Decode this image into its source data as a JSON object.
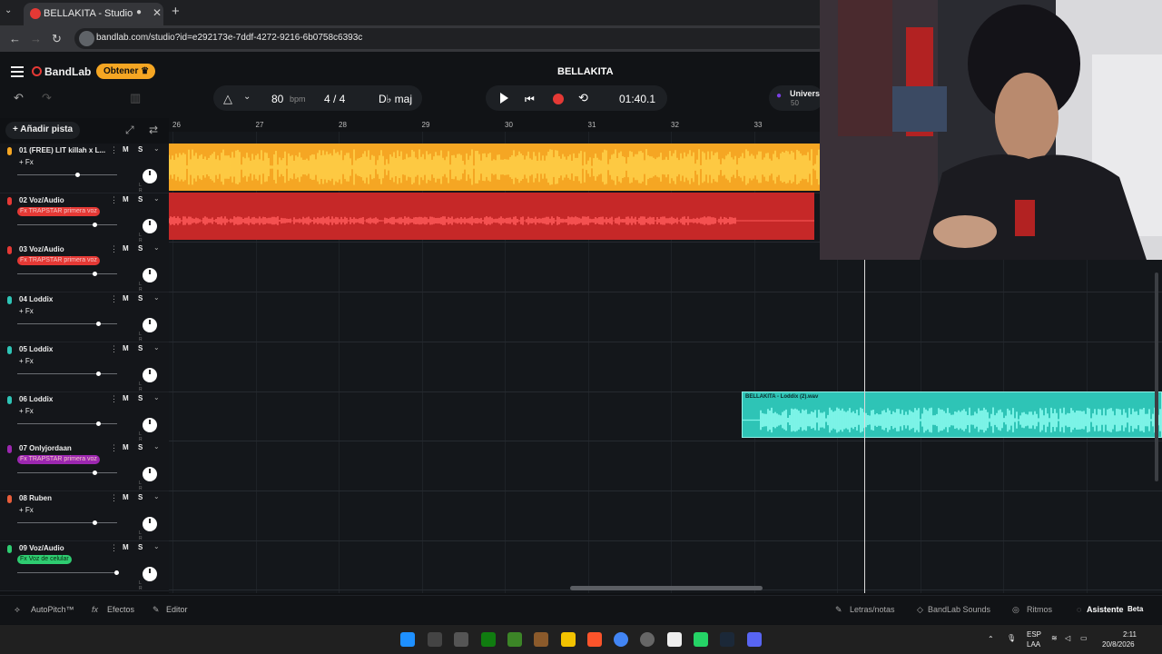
{
  "browser": {
    "tab_title": "BELLAKITA - Studio",
    "tab_chevron": "⌄",
    "close_glyph": "✕",
    "newtab_glyph": "+",
    "url": "bandlab.com/studio?id=e292173e-7ddf-4272-9216-6b0758c6393c"
  },
  "header": {
    "app_name": "BandLab",
    "obtener_label": "Obtener",
    "project_title": "BELLAKITA",
    "bpm_value": "80",
    "bpm_unit": "bpm",
    "time_signature": "4 / 4",
    "key": "D♭ maj",
    "time": "01:40.1",
    "universe_label": "Universo",
    "universe_count": "50"
  },
  "tracklist": {
    "add_track_label": "+ Añadir pista",
    "tracks": [
      {
        "name": "01  (FREE) LIT killah x L...",
        "fx": "+ Fx",
        "color": "#f5a623",
        "fx_color": ""
      },
      {
        "name": "02  Voz/Audio",
        "fx": "Fx TRAPSTAR primera voz",
        "color": "#e53935",
        "fx_color": "#e53935"
      },
      {
        "name": "03  Voz/Audio",
        "fx": "Fx TRAPSTAR primera voz",
        "color": "#e53935",
        "fx_color": "#e53935"
      },
      {
        "name": "04  Loddix",
        "fx": "+ Fx",
        "color": "#2ec4b6",
        "fx_color": ""
      },
      {
        "name": "05  Loddix",
        "fx": "+ Fx",
        "color": "#2ec4b6",
        "fx_color": ""
      },
      {
        "name": "06  Loddix",
        "fx": "+ Fx",
        "color": "#2ec4b6",
        "fx_color": ""
      },
      {
        "name": "07  Onlyjordaan",
        "fx": "Fx TRAPSTAR primera voz",
        "color": "#9c27b0",
        "fx_color": "#9c27b0"
      },
      {
        "name": "08  Ruben",
        "fx": "+ Fx",
        "color": "#e85d3a",
        "fx_color": ""
      },
      {
        "name": "09  Voz/Audio",
        "fx": "Fx Voz de celular",
        "color": "#2ecc71",
        "fx_color": "#2ecc71"
      }
    ],
    "mute_label": "M",
    "solo_label": "S",
    "lr_label": "L R"
  },
  "ruler": {
    "bars": [
      "26",
      "27",
      "28",
      "29",
      "30",
      "31",
      "32",
      "33"
    ]
  },
  "clips": {
    "loddix_clip_title": "BELLAKITA - Loddix (2).wav"
  },
  "bottom": {
    "autopitch": "AutoPitch™",
    "efectos": "Efectos",
    "editor": "Editor",
    "letras": "Letras/notas",
    "sounds": "BandLab Sounds",
    "ritmos": "Ritmos",
    "asistente": "Asistente",
    "beta": "Beta"
  },
  "taskbar": {
    "lang_line1": "ESP",
    "lang_line2": "LAA",
    "clock_time": "2:11",
    "clock_date": "20/8/2026"
  },
  "colors": {
    "accent": "#f5a623",
    "record": "#e53935",
    "teal_clip": "#2ec4b6"
  }
}
